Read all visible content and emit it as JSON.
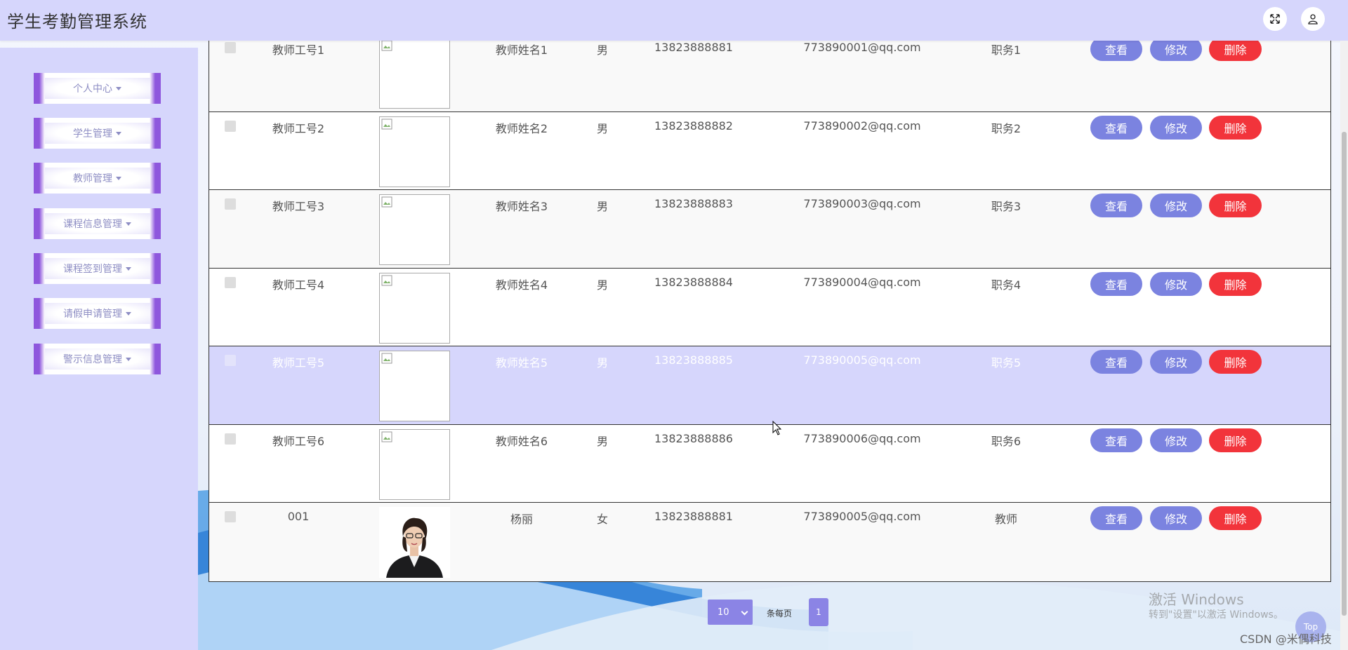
{
  "app": {
    "title": "学生考勤管理系统"
  },
  "header": {
    "fullscreen_icon": "expand-icon",
    "user_icon": "user-icon"
  },
  "sidebar": {
    "items": [
      {
        "label": "个人中心"
      },
      {
        "label": "学生管理"
      },
      {
        "label": "教师管理"
      },
      {
        "label": "课程信息管理"
      },
      {
        "label": "课程签到管理"
      },
      {
        "label": "请假申请管理"
      },
      {
        "label": "警示信息管理"
      }
    ]
  },
  "table": {
    "buttons": {
      "view": "查看",
      "edit": "修改",
      "delete": "删除"
    },
    "rows": [
      {
        "no": "教师工号1",
        "name": "教师姓名1",
        "gender": "男",
        "phone": "13823888881",
        "email": "773890001@qq.com",
        "job": "职务1"
      },
      {
        "no": "教师工号2",
        "name": "教师姓名2",
        "gender": "男",
        "phone": "13823888882",
        "email": "773890002@qq.com",
        "job": "职务2"
      },
      {
        "no": "教师工号3",
        "name": "教师姓名3",
        "gender": "男",
        "phone": "13823888883",
        "email": "773890003@qq.com",
        "job": "职务3"
      },
      {
        "no": "教师工号4",
        "name": "教师姓名4",
        "gender": "男",
        "phone": "13823888884",
        "email": "773890004@qq.com",
        "job": "职务4"
      },
      {
        "no": "教师工号5",
        "name": "教师姓名5",
        "gender": "男",
        "phone": "13823888885",
        "email": "773890005@qq.com",
        "job": "职务5"
      },
      {
        "no": "教师工号6",
        "name": "教师姓名6",
        "gender": "男",
        "phone": "13823888886",
        "email": "773890006@qq.com",
        "job": "职务6"
      },
      {
        "no": "001",
        "name": "杨丽",
        "gender": "女",
        "phone": "13823888881",
        "email": "773890005@qq.com",
        "job": "教师"
      }
    ]
  },
  "pagination": {
    "page_size": "10",
    "per_page_label": "条每页",
    "current_page": "1"
  },
  "watermark": {
    "line1": "激活 Windows",
    "line2": "转到\"设置\"以激活 Windows。"
  },
  "footer": {
    "csdn": "CSDN @米偶科技",
    "top_button": "Top"
  },
  "colors": {
    "header_bg": "#d6d6fc",
    "accent": "#7b83e0",
    "danger": "#f2343b",
    "menu_border": "#8e57dd",
    "highlight_row": "#d6d6fc"
  }
}
